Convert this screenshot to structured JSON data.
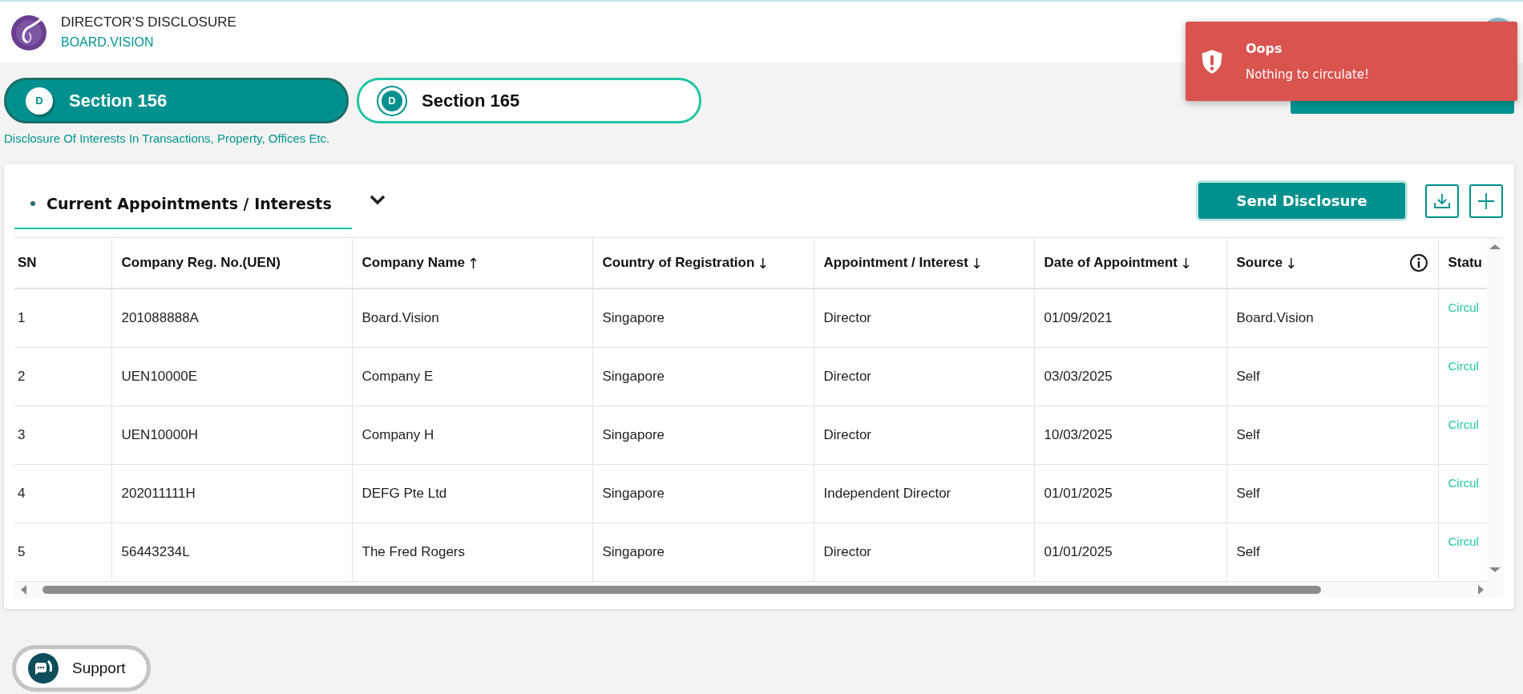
{
  "header": {
    "title": "DIRECTOR’S DISCLOSURE",
    "subtitle": "BOARD.VISION"
  },
  "section_tabs": [
    {
      "badge": "D",
      "label": "Section 156",
      "selected": true
    },
    {
      "badge": "D",
      "label": "Section 165",
      "selected": false
    }
  ],
  "section_description": "Disclosure Of Interests In Transactions, Property, Offices Etc.",
  "toast": {
    "title": "Oops",
    "message": "Nothing to circulate!"
  },
  "card": {
    "tab": "Current Appointments / Interests",
    "send_button": "Send Disclosure"
  },
  "table": {
    "columns": [
      {
        "label": "SN",
        "info": false
      },
      {
        "label": "Company Reg. No.(UEN)",
        "info": false
      },
      {
        "label": "Company Name",
        "sort_arrow": "↑",
        "info": false
      },
      {
        "label": "Country of Registration",
        "sort_arrow": "↓",
        "info": false
      },
      {
        "label": "Appointment / Interest",
        "sort_arrow": "↓",
        "info": false
      },
      {
        "label": "Date of Appointment",
        "sort_arrow": "↓",
        "info": false
      },
      {
        "label": "Source",
        "sort_arrow": "↓",
        "info": true
      },
      {
        "label": "Statu",
        "info": false
      }
    ],
    "rows": [
      {
        "cells": [
          "1",
          "201088888A",
          "Board.Vision",
          "Singapore",
          "Director",
          "01/09/2021",
          "Board.Vision",
          "Circul"
        ]
      },
      {
        "cells": [
          "2",
          "UEN10000E",
          "Company E",
          "Singapore",
          "Director",
          "03/03/2025",
          "Self",
          "Circul"
        ]
      },
      {
        "cells": [
          "3",
          "UEN10000H",
          "Company H",
          "Singapore",
          "Director",
          "10/03/2025",
          "Self",
          "Circul"
        ]
      },
      {
        "cells": [
          "4",
          "202011111H",
          "DEFG Pte Ltd",
          "Singapore",
          "Independent Director",
          "01/01/2025",
          "Self",
          "Circul"
        ]
      },
      {
        "cells": [
          "5",
          "56443234L",
          "The Fred Rogers",
          "Singapore",
          "Director",
          "01/01/2025",
          "Self",
          "Circul"
        ]
      }
    ]
  },
  "support_button": "Support"
}
